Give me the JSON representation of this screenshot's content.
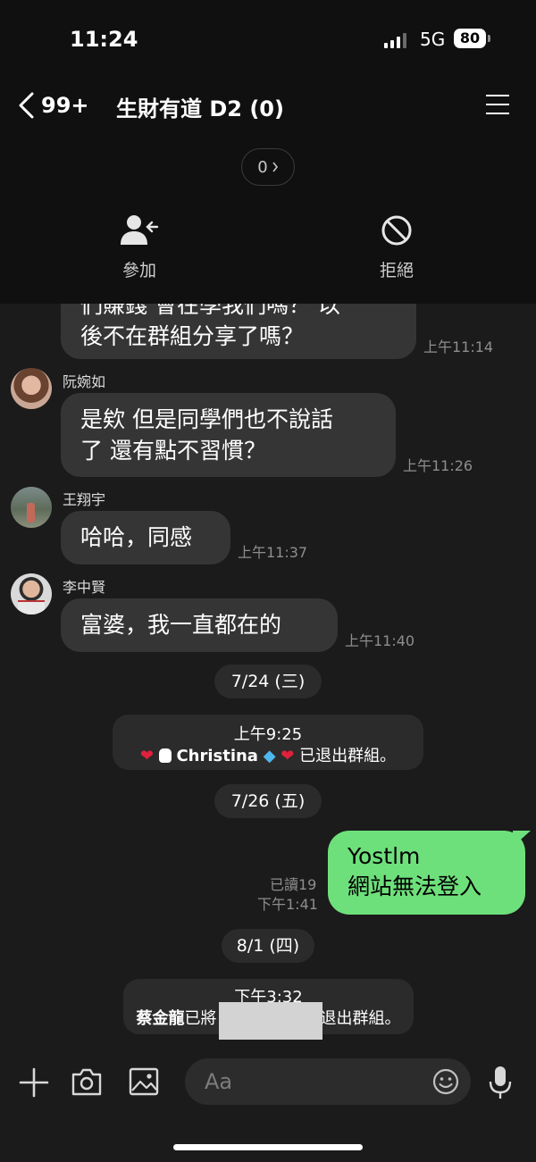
{
  "status_bar": {
    "time": "11:24",
    "network": "5G",
    "battery": "80"
  },
  "header": {
    "back_count": "99+",
    "title": "生財有道 D2 (0)",
    "counter": "0",
    "actions": {
      "join_label": "參加",
      "reject_label": "拒絕"
    }
  },
  "messages": [
    {
      "text_line1": "們賺錢 會在學我們嗎？ 以",
      "text_line2": "後不在群組分享了嗎？",
      "time": "上午11:14"
    },
    {
      "sender": "阮婉如",
      "text_line1": "是欸 但是同學們也不說話",
      "text_line2": "了 還有點不習慣？",
      "time": "上午11:26"
    },
    {
      "sender": "王翔宇",
      "text": "哈哈，同感",
      "time": "上午11:37"
    },
    {
      "sender": "李中賢",
      "text": "富婆，我一直都在的",
      "time": "上午11:40"
    }
  ],
  "dates": {
    "d1": "7/24 (三)",
    "d2": "7/26 (五)",
    "d3": "8/1 (四)"
  },
  "system_messages": {
    "left_group": {
      "time": "上午9:25",
      "name": "Christina",
      "suffix": "已退出群組。"
    },
    "removed": {
      "time": "下午3:32",
      "actor": "蔡金龍",
      "verb": "已將",
      "suffix": "退出群組。"
    }
  },
  "my_message": {
    "line1": "Yostlm",
    "line2": "網站無法登入",
    "read": "已讀19",
    "time": "下午1:41"
  },
  "input": {
    "placeholder": "Aa"
  },
  "colors": {
    "accent_green": "#6ee07b",
    "background": "#1b1b1b",
    "bubble": "#353535"
  }
}
